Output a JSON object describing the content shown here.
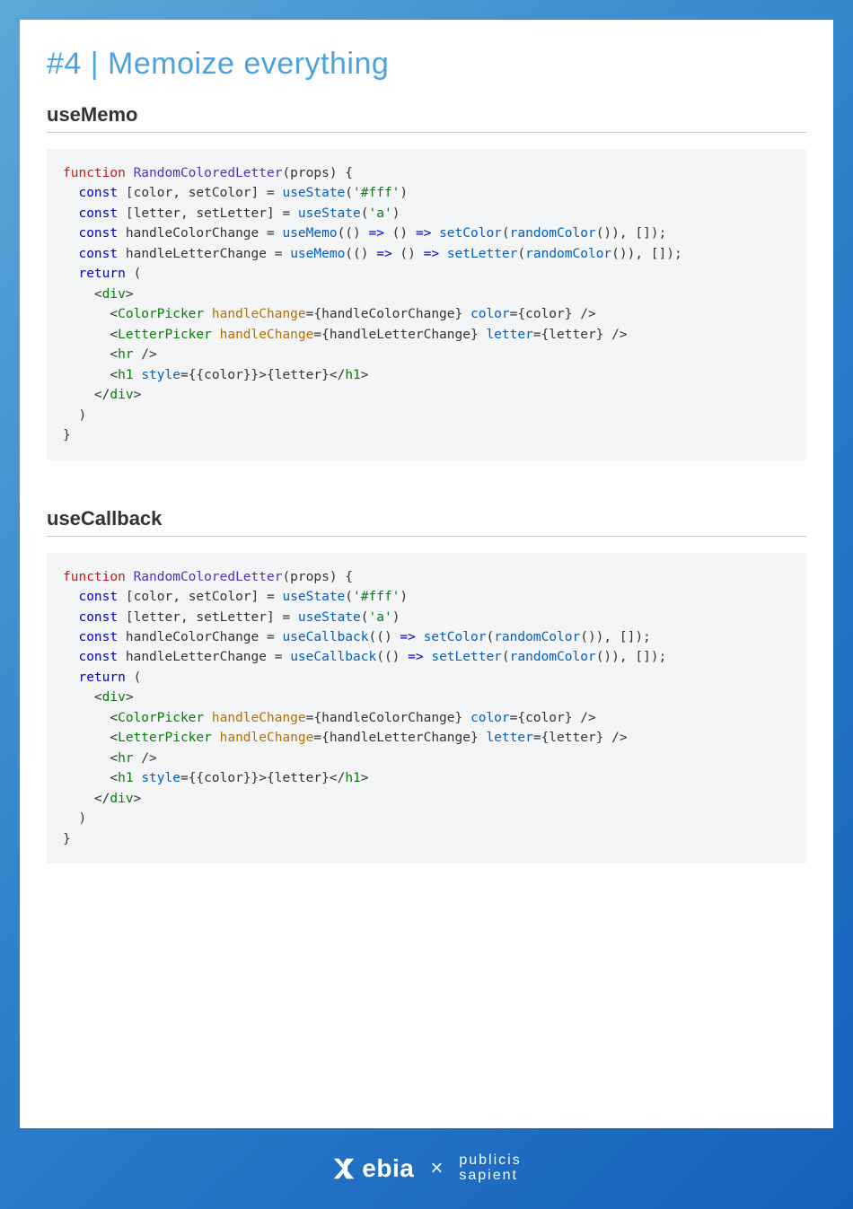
{
  "title": "#4 | Memoize everything",
  "sections": [
    {
      "heading": "useMemo",
      "code": {
        "tokens": [
          {
            "t": "function ",
            "c": "fn"
          },
          {
            "t": "RandomColoredLetter",
            "c": "name"
          },
          {
            "t": "(props) {\n",
            "c": ""
          },
          {
            "t": "  ",
            "c": ""
          },
          {
            "t": "const",
            "c": "kw"
          },
          {
            "t": " [color, setColor] = ",
            "c": ""
          },
          {
            "t": "useState",
            "c": "call"
          },
          {
            "t": "(",
            "c": ""
          },
          {
            "t": "'#fff'",
            "c": "str"
          },
          {
            "t": ")\n",
            "c": ""
          },
          {
            "t": "  ",
            "c": ""
          },
          {
            "t": "const",
            "c": "kw"
          },
          {
            "t": " [letter, setLetter] = ",
            "c": ""
          },
          {
            "t": "useState",
            "c": "call"
          },
          {
            "t": "(",
            "c": ""
          },
          {
            "t": "'a'",
            "c": "str"
          },
          {
            "t": ")\n",
            "c": ""
          },
          {
            "t": "  ",
            "c": ""
          },
          {
            "t": "const",
            "c": "kw"
          },
          {
            "t": " handleColorChange = ",
            "c": ""
          },
          {
            "t": "useMemo",
            "c": "call"
          },
          {
            "t": "(() ",
            "c": ""
          },
          {
            "t": "=>",
            "c": "kw"
          },
          {
            "t": " () ",
            "c": ""
          },
          {
            "t": "=>",
            "c": "kw"
          },
          {
            "t": " ",
            "c": ""
          },
          {
            "t": "setColor",
            "c": "call"
          },
          {
            "t": "(",
            "c": ""
          },
          {
            "t": "randomColor",
            "c": "call"
          },
          {
            "t": "()), []);\n",
            "c": ""
          },
          {
            "t": "  ",
            "c": ""
          },
          {
            "t": "const",
            "c": "kw"
          },
          {
            "t": " handleLetterChange = ",
            "c": ""
          },
          {
            "t": "useMemo",
            "c": "call"
          },
          {
            "t": "(() ",
            "c": ""
          },
          {
            "t": "=>",
            "c": "kw"
          },
          {
            "t": " () ",
            "c": ""
          },
          {
            "t": "=>",
            "c": "kw"
          },
          {
            "t": " ",
            "c": ""
          },
          {
            "t": "setLetter",
            "c": "call"
          },
          {
            "t": "(",
            "c": ""
          },
          {
            "t": "randomColor",
            "c": "call"
          },
          {
            "t": "()), []);\n",
            "c": ""
          },
          {
            "t": "  ",
            "c": ""
          },
          {
            "t": "return",
            "c": "kw"
          },
          {
            "t": " (\n",
            "c": ""
          },
          {
            "t": "    <",
            "c": ""
          },
          {
            "t": "div",
            "c": "tag"
          },
          {
            "t": ">\n",
            "c": ""
          },
          {
            "t": "      <",
            "c": ""
          },
          {
            "t": "ColorPicker",
            "c": "tag"
          },
          {
            "t": " ",
            "c": ""
          },
          {
            "t": "handleChange",
            "c": "attrname"
          },
          {
            "t": "=",
            "c": ""
          },
          {
            "t": "{handleColorChange}",
            "c": ""
          },
          {
            "t": " ",
            "c": ""
          },
          {
            "t": "color",
            "c": "attr"
          },
          {
            "t": "=",
            "c": ""
          },
          {
            "t": "{color}",
            "c": ""
          },
          {
            "t": " />\n",
            "c": ""
          },
          {
            "t": "      <",
            "c": ""
          },
          {
            "t": "LetterPicker",
            "c": "tag"
          },
          {
            "t": " ",
            "c": ""
          },
          {
            "t": "handleChange",
            "c": "attrname"
          },
          {
            "t": "=",
            "c": ""
          },
          {
            "t": "{handleLetterChange}",
            "c": ""
          },
          {
            "t": " ",
            "c": ""
          },
          {
            "t": "letter",
            "c": "attr"
          },
          {
            "t": "=",
            "c": ""
          },
          {
            "t": "{letter}",
            "c": ""
          },
          {
            "t": " />\n",
            "c": ""
          },
          {
            "t": "      <",
            "c": ""
          },
          {
            "t": "hr",
            "c": "tag"
          },
          {
            "t": " />\n",
            "c": ""
          },
          {
            "t": "      <",
            "c": ""
          },
          {
            "t": "h1",
            "c": "tag"
          },
          {
            "t": " ",
            "c": ""
          },
          {
            "t": "style",
            "c": "attr"
          },
          {
            "t": "=",
            "c": ""
          },
          {
            "t": "{{color}}",
            "c": ""
          },
          {
            "t": ">{letter}</",
            "c": ""
          },
          {
            "t": "h1",
            "c": "tag"
          },
          {
            "t": ">\n",
            "c": ""
          },
          {
            "t": "    </",
            "c": ""
          },
          {
            "t": "div",
            "c": "tag"
          },
          {
            "t": ">\n",
            "c": ""
          },
          {
            "t": "  )\n",
            "c": ""
          },
          {
            "t": "}",
            "c": ""
          }
        ]
      }
    },
    {
      "heading": "useCallback",
      "code": {
        "tokens": [
          {
            "t": "function ",
            "c": "fn"
          },
          {
            "t": "RandomColoredLetter",
            "c": "name"
          },
          {
            "t": "(props) {\n",
            "c": ""
          },
          {
            "t": "  ",
            "c": ""
          },
          {
            "t": "const",
            "c": "kw"
          },
          {
            "t": " [color, setColor] = ",
            "c": ""
          },
          {
            "t": "useState",
            "c": "call"
          },
          {
            "t": "(",
            "c": ""
          },
          {
            "t": "'#fff'",
            "c": "str"
          },
          {
            "t": ")\n",
            "c": ""
          },
          {
            "t": "  ",
            "c": ""
          },
          {
            "t": "const",
            "c": "kw"
          },
          {
            "t": " [letter, setLetter] = ",
            "c": ""
          },
          {
            "t": "useState",
            "c": "call"
          },
          {
            "t": "(",
            "c": ""
          },
          {
            "t": "'a'",
            "c": "str"
          },
          {
            "t": ")\n",
            "c": ""
          },
          {
            "t": "  ",
            "c": ""
          },
          {
            "t": "const",
            "c": "kw"
          },
          {
            "t": " handleColorChange = ",
            "c": ""
          },
          {
            "t": "useCallback",
            "c": "call"
          },
          {
            "t": "(() ",
            "c": ""
          },
          {
            "t": "=>",
            "c": "kw"
          },
          {
            "t": " ",
            "c": ""
          },
          {
            "t": "setColor",
            "c": "call"
          },
          {
            "t": "(",
            "c": ""
          },
          {
            "t": "randomColor",
            "c": "call"
          },
          {
            "t": "()), []);\n",
            "c": ""
          },
          {
            "t": "  ",
            "c": ""
          },
          {
            "t": "const",
            "c": "kw"
          },
          {
            "t": " handleLetterChange = ",
            "c": ""
          },
          {
            "t": "useCallback",
            "c": "call"
          },
          {
            "t": "(() ",
            "c": ""
          },
          {
            "t": "=>",
            "c": "kw"
          },
          {
            "t": " ",
            "c": ""
          },
          {
            "t": "setLetter",
            "c": "call"
          },
          {
            "t": "(",
            "c": ""
          },
          {
            "t": "randomColor",
            "c": "call"
          },
          {
            "t": "()), []);\n",
            "c": ""
          },
          {
            "t": "  ",
            "c": ""
          },
          {
            "t": "return",
            "c": "kw"
          },
          {
            "t": " (\n",
            "c": ""
          },
          {
            "t": "    <",
            "c": ""
          },
          {
            "t": "div",
            "c": "tag"
          },
          {
            "t": ">\n",
            "c": ""
          },
          {
            "t": "      <",
            "c": ""
          },
          {
            "t": "ColorPicker",
            "c": "tag"
          },
          {
            "t": " ",
            "c": ""
          },
          {
            "t": "handleChange",
            "c": "attrname"
          },
          {
            "t": "=",
            "c": ""
          },
          {
            "t": "{handleColorChange}",
            "c": ""
          },
          {
            "t": " ",
            "c": ""
          },
          {
            "t": "color",
            "c": "attr"
          },
          {
            "t": "=",
            "c": ""
          },
          {
            "t": "{color}",
            "c": ""
          },
          {
            "t": " />\n",
            "c": ""
          },
          {
            "t": "      <",
            "c": ""
          },
          {
            "t": "LetterPicker",
            "c": "tag"
          },
          {
            "t": " ",
            "c": ""
          },
          {
            "t": "handleChange",
            "c": "attrname"
          },
          {
            "t": "=",
            "c": ""
          },
          {
            "t": "{handleLetterChange}",
            "c": ""
          },
          {
            "t": " ",
            "c": ""
          },
          {
            "t": "letter",
            "c": "attr"
          },
          {
            "t": "=",
            "c": ""
          },
          {
            "t": "{letter}",
            "c": ""
          },
          {
            "t": " />\n",
            "c": ""
          },
          {
            "t": "      <",
            "c": ""
          },
          {
            "t": "hr",
            "c": "tag"
          },
          {
            "t": " />\n",
            "c": ""
          },
          {
            "t": "      <",
            "c": ""
          },
          {
            "t": "h1",
            "c": "tag"
          },
          {
            "t": " ",
            "c": ""
          },
          {
            "t": "style",
            "c": "attr"
          },
          {
            "t": "=",
            "c": ""
          },
          {
            "t": "{{color}}",
            "c": ""
          },
          {
            "t": ">{letter}</",
            "c": ""
          },
          {
            "t": "h1",
            "c": "tag"
          },
          {
            "t": ">\n",
            "c": ""
          },
          {
            "t": "    </",
            "c": ""
          },
          {
            "t": "div",
            "c": "tag"
          },
          {
            "t": ">\n",
            "c": ""
          },
          {
            "t": "  )\n",
            "c": ""
          },
          {
            "t": "}",
            "c": ""
          }
        ]
      }
    }
  ],
  "footer": {
    "brand1": "ebia",
    "separator": "×",
    "brand2_line1": "publicis",
    "brand2_line2": "sapient"
  }
}
